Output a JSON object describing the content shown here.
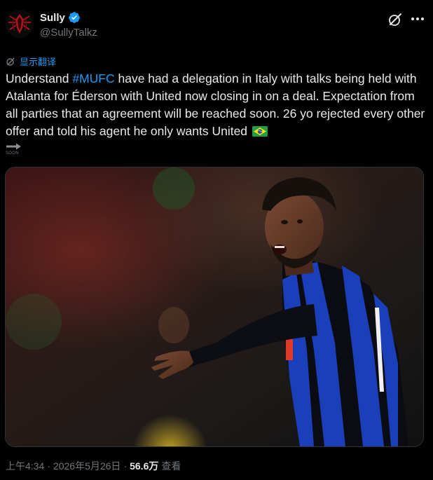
{
  "author": {
    "display_name": "Sully",
    "handle": "@SullyTalkz"
  },
  "translate_label": "显示翻译",
  "tweet": {
    "text_before_hashtag": "Understand ",
    "hashtag": "#MUFC",
    "text_after_hashtag": " have had a delegation in Italy with talks being held with Atalanta for Éderson with United now closing in on a deal. Expectation from all parties that an agreement will be reached soon. 26 yo rejected every other offer and told his agent he only wants United ",
    "flag_emoji": "brazil-flag"
  },
  "soon_label": "SOON",
  "meta": {
    "time": "上午4:34",
    "separator": "·",
    "date": "2026年5月26日",
    "views_count": "56.6万",
    "views_label": "查看"
  },
  "colors": {
    "background": "#000000",
    "text": "#e7e9ea",
    "muted": "#71767b",
    "link": "#1d9bf0",
    "verified": "#1d9bf0",
    "jersey_blue": "#1a3fb8",
    "jersey_black": "#0b0b12"
  },
  "icons": [
    "avatar-spider-logo",
    "verified-badge-icon",
    "grok-icon",
    "more-icon",
    "translate-icon",
    "soon-arrow-icon"
  ]
}
